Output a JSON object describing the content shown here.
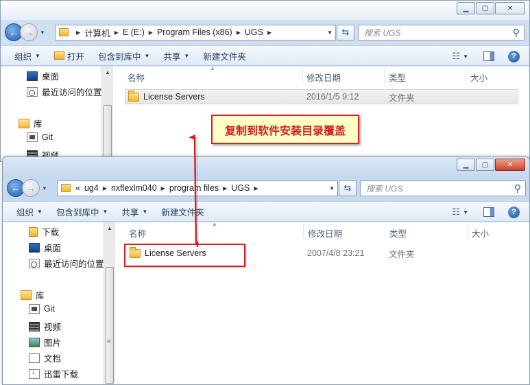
{
  "back_window": {
    "address": {
      "crumbs": [
        "计算机",
        "E (E:)",
        "Program Files (x86)",
        "UGS"
      ]
    },
    "search_placeholder": "搜索 UGS",
    "toolbar": {
      "organize": "组织",
      "open": "打开",
      "include_in_library": "包含到库中",
      "share": "共享",
      "new_folder": "新建文件夹"
    },
    "nav": {
      "desktop": "桌面",
      "recent": "最近访问的位置",
      "libraries": "库",
      "git": "Git",
      "videos": "视频"
    },
    "columns": {
      "name": "名称",
      "date": "修改日期",
      "type": "类型",
      "size": "大小"
    },
    "files": [
      {
        "name": "License Servers",
        "date": "2016/1/5 9:12",
        "type": "文件夹",
        "selected": true
      }
    ]
  },
  "front_window": {
    "address": {
      "prefix": "«",
      "crumbs": [
        "ug4",
        "nxflexlm040",
        "program files",
        "UGS"
      ]
    },
    "search_placeholder": "搜索 UGS",
    "toolbar": {
      "organize": "组织",
      "include_in_library": "包含到库中",
      "share": "共享",
      "new_folder": "新建文件夹"
    },
    "nav": {
      "downloads": "下载",
      "desktop": "桌面",
      "recent": "最近访问的位置",
      "libraries": "库",
      "git": "Git",
      "videos": "视频",
      "pictures": "图片",
      "documents": "文档",
      "thunder_downloads": "迅雷下载"
    },
    "columns": {
      "name": "名称",
      "date": "修改日期",
      "type": "类型",
      "size": "大小"
    },
    "files": [
      {
        "name": "License Servers",
        "date": "2007/4/8 23:21",
        "type": "文件夹"
      }
    ]
  },
  "annotation": {
    "callout_text": "复制到软件安装目录覆盖",
    "color": "#d62020",
    "background": "#ffffc8"
  },
  "icons": {
    "back": "back-arrow-icon",
    "forward": "forward-arrow-icon",
    "refresh": "refresh-icon",
    "search": "search-icon",
    "help": "help-icon",
    "folder": "folder-icon"
  }
}
